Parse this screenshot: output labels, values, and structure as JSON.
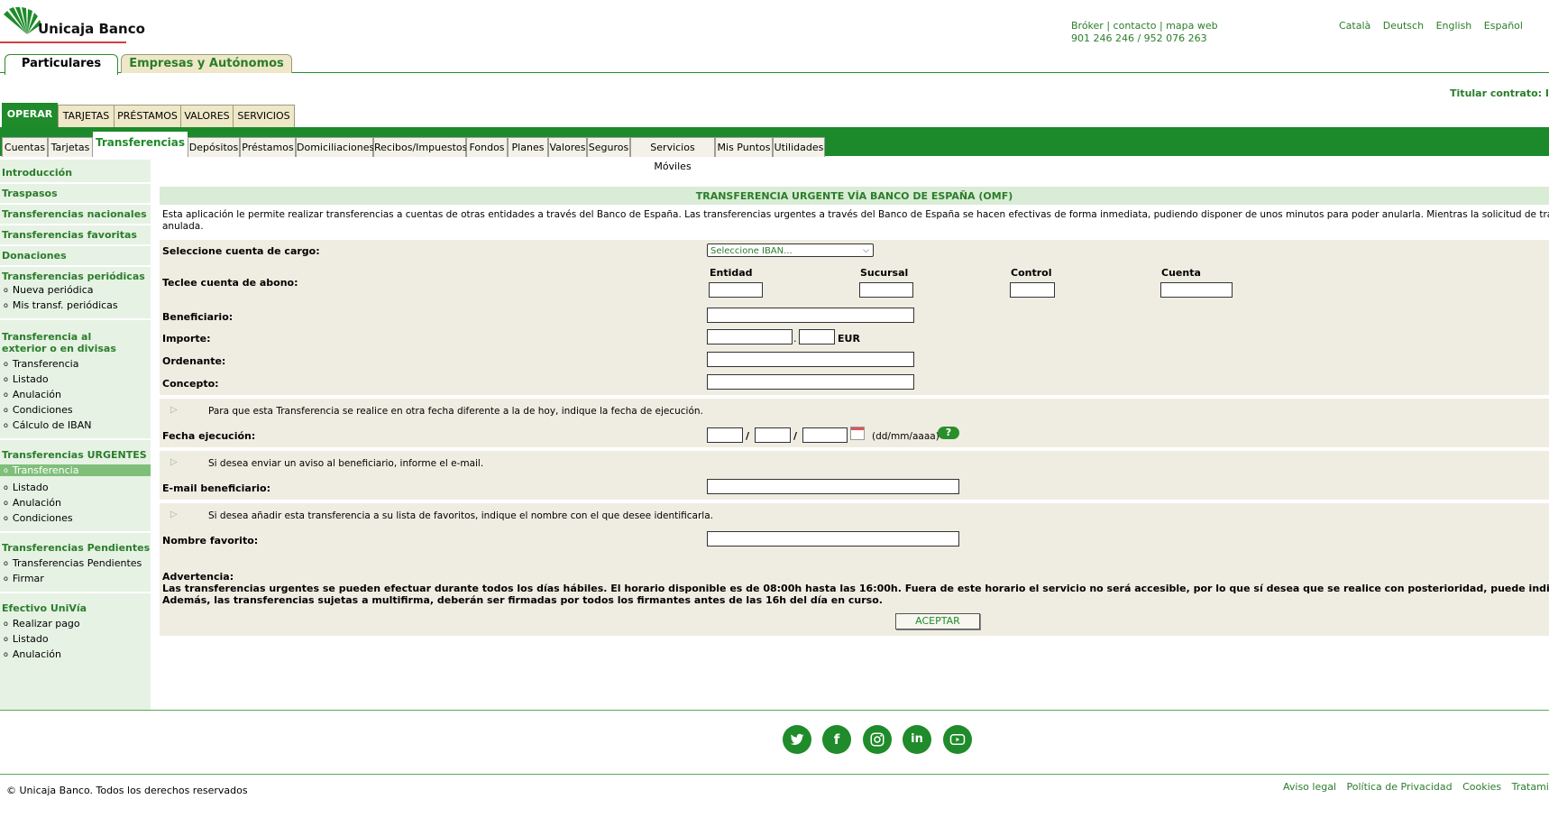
{
  "brand": {
    "name": "Unicaja Banco"
  },
  "header": {
    "links": [
      "Bróker",
      "contacto",
      "mapa web"
    ],
    "link_sep": "|",
    "phones": "901 246 246 / 952 076 263",
    "languages": [
      "Català",
      "Deutsch",
      "English",
      "Español"
    ],
    "titular": "Titular contrato: I"
  },
  "segments": [
    "Particulares",
    "Empresas y Autónomos"
  ],
  "main_tabs": [
    "OPERAR",
    "TARJETAS",
    "PRÉSTAMOS",
    "VALORES",
    "SERVICIOS"
  ],
  "sub_tabs": [
    "Cuentas",
    "Tarjetas",
    "Transferencias",
    "Depósitos",
    "Préstamos",
    "Domiciliaciones",
    "Recibos/Impuestos",
    "Fondos",
    "Planes",
    "Valores",
    "Seguros",
    "Servicios Móviles",
    "Mis Puntos",
    "Utilidades"
  ],
  "sidebar": {
    "sections": [
      {
        "title": "Introducción",
        "items": []
      },
      {
        "title": "Traspasos",
        "items": []
      },
      {
        "title": "Transferencias nacionales",
        "items": []
      },
      {
        "title": "Transferencias favoritas",
        "items": []
      },
      {
        "title": "Donaciones",
        "items": []
      },
      {
        "title": "Transferencias periódicas",
        "items": [
          "Nueva periódica",
          "Mis transf. periódicas"
        ]
      },
      {
        "title": "Transferencia al exterior o en divisas",
        "items": [
          "Transferencia",
          "Listado",
          "Anulación",
          "Condiciones",
          "Cálculo de IBAN"
        ]
      },
      {
        "title": "Transferencias URGENTES",
        "items": [
          "Transferencia",
          "Listado",
          "Anulación",
          "Condiciones"
        ]
      },
      {
        "title": "Transferencias Pendientes",
        "items": [
          "Transferencias Pendientes",
          "Firmar"
        ]
      },
      {
        "title": "Efectivo UniVía",
        "items": [
          "Realizar pago",
          "Listado",
          "Anulación"
        ]
      }
    ]
  },
  "form": {
    "title": "TRANSFERENCIA URGENTE VÍA BANCO DE ESPAÑA (OMF)",
    "intro_line1": "Esta aplicación le permite realizar transferencias a cuentas de otras entidades a través del Banco de España. Las transferencias urgentes a través del Banco de España se hacen efectivas de forma inmediata, pudiendo disponer de unos minutos para poder anularla. Mientras la solicitud de transferencia se encuentre P",
    "intro_line2": "anulada.",
    "cuenta_cargo_label": "Seleccione cuenta de cargo:",
    "cuenta_cargo_value": "Seleccione IBAN...",
    "cuenta_abono_label": "Teclee cuenta de abono:",
    "abono_cols": [
      "Entidad",
      "Sucursal",
      "Control",
      "Cuenta"
    ],
    "beneficiario_label": "Beneficiario:",
    "importe_label": "Importe:",
    "importe_sep": ".",
    "currency": "EUR",
    "ordenante_label": "Ordenante:",
    "concepto_label": "Concepto:",
    "fecha_hint": "Para que esta Transferencia se realice en otra fecha diferente a la de hoy, indique la fecha de ejecución.",
    "fecha_label": "Fecha ejecución:",
    "date_sep": "/",
    "date_format": "(dd/mm/aaaa)",
    "help": "?",
    "email_hint": "Si desea enviar un aviso al beneficiario, informe el e-mail.",
    "email_label": "E-mail beneficiario:",
    "fav_hint": "Si desea añadir esta transferencia a su lista de favoritos, indique el nombre con el que desee identificarla.",
    "fav_label": "Nombre favorito:",
    "warning_title": "Advertencia:",
    "warning_line1": "Las transferencias urgentes se pueden efectuar durante todos los días hábiles. El horario disponible es de 08:00h hasta las 16:00h. Fuera de este horario el servicio no será accesible, por lo que sí desea que se realice con posterioridad, puede indicar una fecha de ejecución en la c",
    "warning_line2": "Además, las transferencias sujetas a multifirma, deberán ser firmadas por todos los firmantes antes de las 16h del día en curso.",
    "accept": "ACEPTAR"
  },
  "footer": {
    "social": [
      "twitter-icon",
      "facebook-icon",
      "instagram-icon",
      "linkedin-icon",
      "youtube-icon"
    ],
    "copyright": "© Unicaja Banco. Todos los derechos reservados",
    "legal": [
      "Aviso legal",
      "Política de Privacidad",
      "Cookies",
      "Tratamiento de"
    ]
  }
}
